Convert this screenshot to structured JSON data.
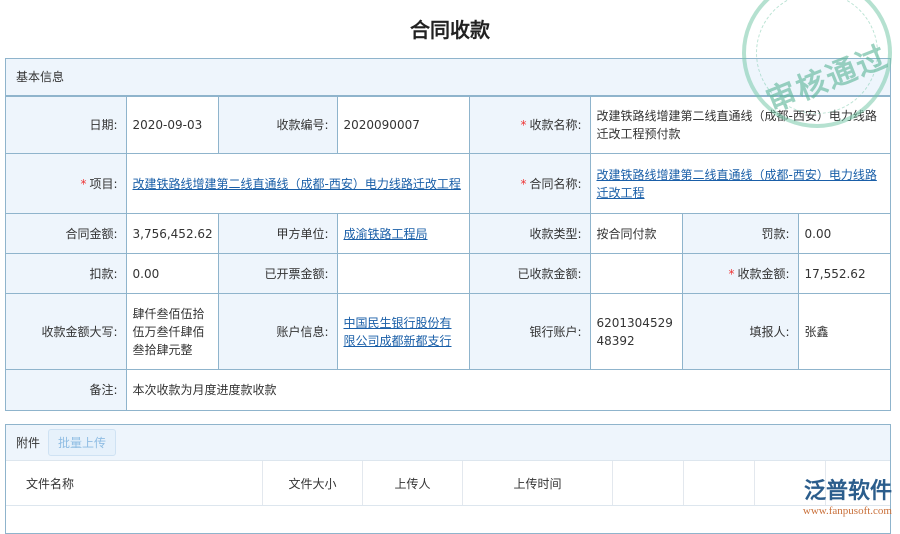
{
  "title": "合同收款",
  "stamp": "审核通过",
  "basic": {
    "header": "基本信息",
    "date_label": "日期:",
    "date": "2020-09-03",
    "no_label": "收款编号:",
    "no": "2020090007",
    "name_label": "收款名称:",
    "name": "改建铁路线增建第二线直通线（成都-西安）电力线路迁改工程预付款",
    "project_label": "项目:",
    "project": "改建铁路线增建第二线直通线（成都-西安）电力线路迁改工程",
    "contract_label": "合同名称:",
    "contract": "改建铁路线增建第二线直通线（成都-西安）电力线路迁改工程",
    "amount_label": "合同金额:",
    "amount": "3,756,452.62",
    "party_label": "甲方单位:",
    "party": "成渝铁路工程局",
    "type_label": "收款类型:",
    "type": "按合同付款",
    "penalty_label": "罚款:",
    "penalty": "0.00",
    "deduct_label": "扣款:",
    "deduct": "0.00",
    "invoiced_label": "已开票金额:",
    "invoiced": "",
    "received_label": "已收款金额:",
    "received": "",
    "receipt_label": "收款金额:",
    "receipt": "17,552.62",
    "upper_label": "收款金额大写:",
    "upper": "肆仟叁佰伍拾伍万叁仟肆佰叁拾肆元整",
    "account_label": "账户信息:",
    "account": "中国民生银行股份有限公司成都新都支行",
    "bank_label": "银行账户:",
    "bank": "620130452948392",
    "reporter_label": "填报人:",
    "reporter": "张鑫",
    "remark_label": "备注:",
    "remark": "本次收款为月度进度款收款"
  },
  "attachments": {
    "header": "附件",
    "upload": "批量上传",
    "columns": [
      "文件名称",
      "文件大小",
      "上传人",
      "上传时间"
    ]
  },
  "logo": {
    "name": "泛普软件",
    "url": "www.fanpusoft.com"
  }
}
